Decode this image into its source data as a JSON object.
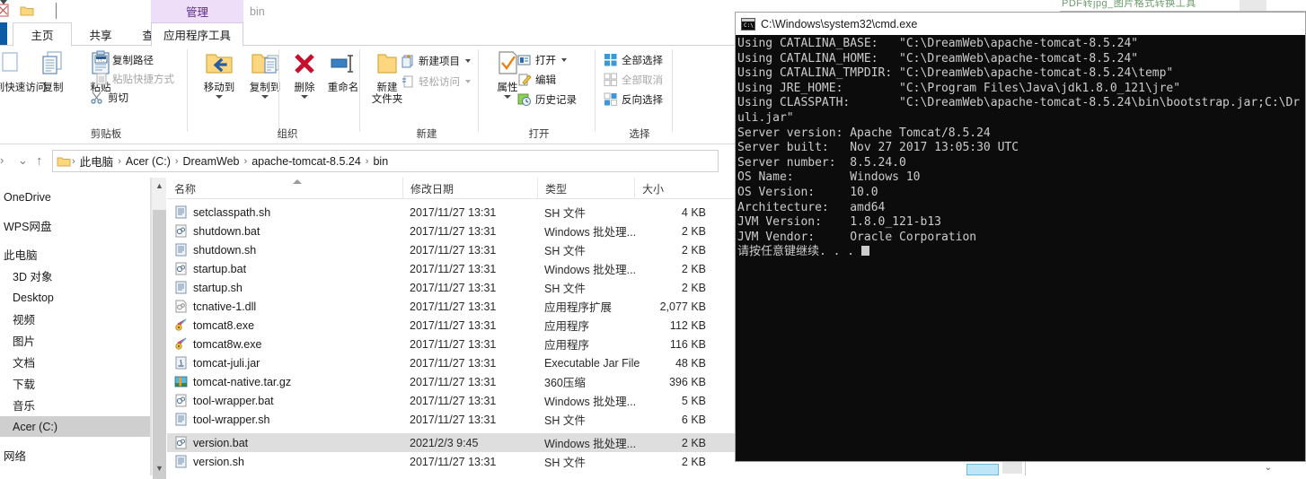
{
  "explorer": {
    "quick_access": {
      "pin_icon": "pin-icon",
      "folder_icon": "folder-icon",
      "dropdown_icon": "chevron-down-icon"
    },
    "contextual_tab_header": "管理",
    "window_title": "bin",
    "tabs": [
      {
        "label": "主页",
        "active": true
      },
      {
        "label": "共享",
        "active": false
      },
      {
        "label": "查看",
        "active": false
      },
      {
        "label": "应用程序工具",
        "active": false,
        "contextual": true
      }
    ],
    "ribbon": {
      "groups": [
        {
          "label": "剪贴板"
        },
        {
          "label": "组织"
        },
        {
          "label": "新建"
        },
        {
          "label": "打开"
        },
        {
          "label": "选择"
        }
      ],
      "clipboard": {
        "pin_label": "固定到快速访问",
        "copy_label": "复制",
        "paste_label": "粘贴",
        "copy_path_label": "复制路径",
        "paste_shortcut_label": "粘贴快捷方式",
        "cut_label": "剪切"
      },
      "organize": {
        "move_to_label": "移动到",
        "copy_to_label": "复制到",
        "delete_label": "删除",
        "rename_label": "重命名"
      },
      "new": {
        "new_folder_label": "新建\n文件夹",
        "new_folder_line1": "新建",
        "new_folder_line2": "文件夹",
        "new_item_label": "新建项目",
        "easy_access_label": "轻松访问"
      },
      "open": {
        "properties_label": "属性",
        "open_label": "打开",
        "edit_label": "编辑",
        "history_label": "历史记录"
      },
      "select": {
        "select_all_label": "全部选择",
        "select_none_label": "全部取消",
        "invert_selection_label": "反向选择"
      }
    },
    "address_bar": {
      "back_icon": "back-arrow-icon",
      "recent_icon": "chevron-down-icon",
      "up_icon": "up-arrow-icon",
      "crumbs": [
        "此电脑",
        "Acer (C:)",
        "DreamWeb",
        "apache-tomcat-8.5.24",
        "bin"
      ],
      "separator": "›"
    },
    "nav_pane": {
      "items": [
        {
          "label": "OneDrive",
          "indent": 0,
          "selected": false
        },
        {
          "label": "WPS网盘",
          "indent": 0,
          "selected": false
        },
        {
          "label": "此电脑",
          "indent": 0,
          "selected": false
        },
        {
          "label": "3D 对象",
          "indent": 1,
          "selected": false
        },
        {
          "label": "Desktop",
          "indent": 1,
          "selected": false
        },
        {
          "label": "视频",
          "indent": 1,
          "selected": false
        },
        {
          "label": "图片",
          "indent": 1,
          "selected": false
        },
        {
          "label": "文档",
          "indent": 1,
          "selected": false
        },
        {
          "label": "下载",
          "indent": 1,
          "selected": false
        },
        {
          "label": "音乐",
          "indent": 1,
          "selected": false
        },
        {
          "label": "Acer (C:)",
          "indent": 1,
          "selected": true
        },
        {
          "label": "网络",
          "indent": 0,
          "selected": false
        }
      ]
    },
    "file_list": {
      "columns": [
        "名称",
        "修改日期",
        "类型",
        "大小"
      ],
      "sorted_column": "名称",
      "rows": [
        {
          "name": "setclasspath.sh",
          "date": "2017/11/27 13:31",
          "type": "SH 文件",
          "size": "4 KB",
          "icon": "sh-file-icon",
          "selected": false
        },
        {
          "name": "shutdown.bat",
          "date": "2017/11/27 13:31",
          "type": "Windows 批处理...",
          "size": "2 KB",
          "icon": "bat-file-icon",
          "selected": false
        },
        {
          "name": "shutdown.sh",
          "date": "2017/11/27 13:31",
          "type": "SH 文件",
          "size": "2 KB",
          "icon": "sh-file-icon",
          "selected": false
        },
        {
          "name": "startup.bat",
          "date": "2017/11/27 13:31",
          "type": "Windows 批处理...",
          "size": "2 KB",
          "icon": "bat-file-icon",
          "selected": false
        },
        {
          "name": "startup.sh",
          "date": "2017/11/27 13:31",
          "type": "SH 文件",
          "size": "2 KB",
          "icon": "sh-file-icon",
          "selected": false
        },
        {
          "name": "tcnative-1.dll",
          "date": "2017/11/27 13:31",
          "type": "应用程序扩展",
          "size": "2,077 KB",
          "icon": "dll-file-icon",
          "selected": false
        },
        {
          "name": "tomcat8.exe",
          "date": "2017/11/27 13:31",
          "type": "应用程序",
          "size": "112 KB",
          "icon": "tomcat-exe-icon",
          "selected": false
        },
        {
          "name": "tomcat8w.exe",
          "date": "2017/11/27 13:31",
          "type": "应用程序",
          "size": "116 KB",
          "icon": "tomcat-exe-icon",
          "selected": false
        },
        {
          "name": "tomcat-juli.jar",
          "date": "2017/11/27 13:31",
          "type": "Executable Jar File",
          "size": "48 KB",
          "icon": "jar-file-icon",
          "selected": false
        },
        {
          "name": "tomcat-native.tar.gz",
          "date": "2017/11/27 13:31",
          "type": "360压缩",
          "size": "396 KB",
          "icon": "archive-icon",
          "selected": false
        },
        {
          "name": "tool-wrapper.bat",
          "date": "2017/11/27 13:31",
          "type": "Windows 批处理...",
          "size": "5 KB",
          "icon": "bat-file-icon",
          "selected": false
        },
        {
          "name": "tool-wrapper.sh",
          "date": "2017/11/27 13:31",
          "type": "SH 文件",
          "size": "6 KB",
          "icon": "sh-file-icon",
          "selected": false
        },
        {
          "name": "version.bat",
          "date": "2021/2/3 9:45",
          "type": "Windows 批处理...",
          "size": "2 KB",
          "icon": "bat-file-icon",
          "selected": true
        },
        {
          "name": "version.sh",
          "date": "2017/11/27 13:31",
          "type": "SH 文件",
          "size": "2 KB",
          "icon": "sh-file-icon",
          "selected": false
        }
      ]
    }
  },
  "cmd": {
    "title": "C:\\Windows\\system32\\cmd.exe",
    "icon": "cmd-icon",
    "lines": [
      "Using CATALINA_BASE:   \"C:\\DreamWeb\\apache-tomcat-8.5.24\"",
      "Using CATALINA_HOME:   \"C:\\DreamWeb\\apache-tomcat-8.5.24\"",
      "Using CATALINA_TMPDIR: \"C:\\DreamWeb\\apache-tomcat-8.5.24\\temp\"",
      "Using JRE_HOME:        \"C:\\Program Files\\Java\\jdk1.8.0_121\\jre\"",
      "Using CLASSPATH:       \"C:\\DreamWeb\\apache-tomcat-8.5.24\\bin\\bootstrap.jar;C:\\Dr",
      "uli.jar\"",
      "Server version: Apache Tomcat/8.5.24",
      "Server built:   Nov 27 2017 13:05:30 UTC",
      "Server number:  8.5.24.0",
      "OS Name:        Windows 10",
      "OS Version:     10.0",
      "Architecture:   amd64",
      "JVM Version:    1.8.0_121-b13",
      "JVM Vendor:     Oracle Corporation"
    ],
    "prompt": "请按任意键继续. . . "
  },
  "background_window": {
    "sliver_text": "PDF转jpg_图片格式转换工具"
  }
}
